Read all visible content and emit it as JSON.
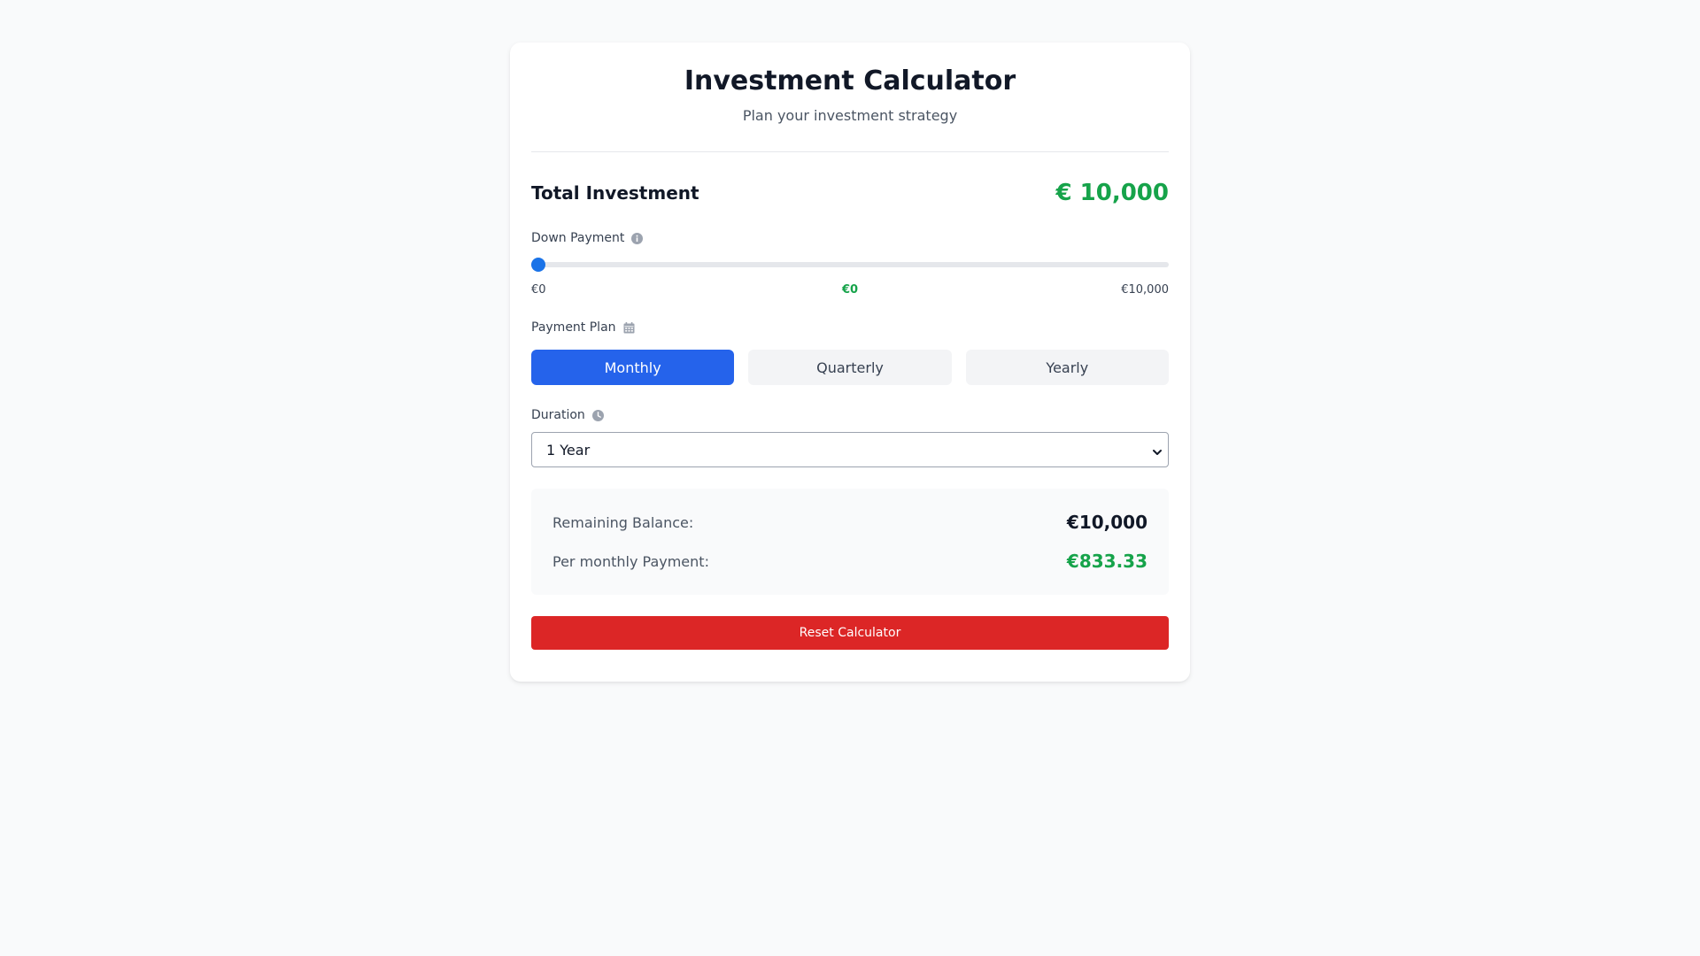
{
  "header": {
    "title": "Investment Calculator",
    "subtitle": "Plan your investment strategy"
  },
  "total": {
    "label": "Total Investment",
    "value": "€ 10,000"
  },
  "down_payment": {
    "label": "Down Payment",
    "icon": "info-icon",
    "min_label": "€0",
    "max_label": "€10,000",
    "current_label": "€0",
    "value": 0,
    "min": 0,
    "max": 10000
  },
  "payment_plan": {
    "label": "Payment Plan",
    "icon": "calendar-icon",
    "options": [
      "Monthly",
      "Quarterly",
      "Yearly"
    ],
    "selected": "Monthly"
  },
  "duration": {
    "label": "Duration",
    "icon": "clock-icon",
    "selected": "1 Year"
  },
  "summary": {
    "remaining_label": "Remaining Balance:",
    "remaining_value": "€10,000",
    "payment_label": "Per monthly Payment:",
    "payment_value": "€833.33"
  },
  "reset_label": "Reset Calculator",
  "colors": {
    "accent": "#2563eb",
    "slider": "#1a73e8",
    "positive": "#16a34a",
    "danger": "#dc2626",
    "background": "#f9fafb"
  }
}
